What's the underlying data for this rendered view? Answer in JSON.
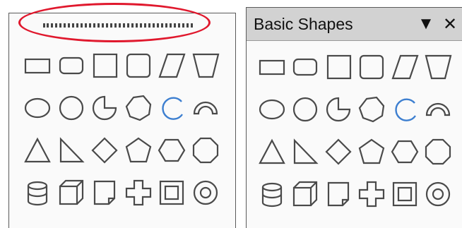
{
  "left_panel": {
    "handle": "drag-handle",
    "highlight": "red-ellipse"
  },
  "right_panel": {
    "title": "Basic Shapes",
    "menu_icon": "dropdown-arrow-icon",
    "close_icon": "close-icon"
  },
  "shapes": [
    [
      "rectangle",
      "rounded-rectangle",
      "square",
      "rounded-square",
      "parallelogram",
      "trapezoid"
    ],
    [
      "ellipse",
      "circle",
      "circle-pie",
      "block-arc-octagon",
      "arc",
      "block-arc"
    ],
    [
      "isosceles-triangle",
      "right-triangle",
      "diamond",
      "pentagon",
      "hexagon",
      "octagon"
    ],
    [
      "cylinder",
      "cube",
      "folded-corner",
      "cross",
      "frame",
      "ring"
    ]
  ],
  "colors": {
    "stroke": "#4a4a4a",
    "arc": "#3d7fd0",
    "highlight": "#e0182d",
    "titlebar": "#d2d2d2"
  }
}
